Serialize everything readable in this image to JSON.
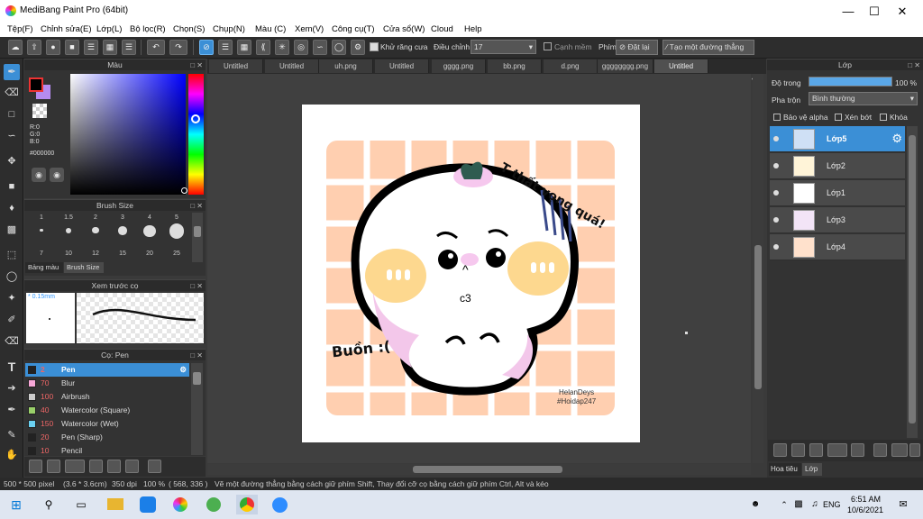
{
  "window": {
    "title": "MediBang Paint Pro (64bit)"
  },
  "menu": [
    "Tệp(F)",
    "Chỉnh sửa(E)",
    "Lớp(L)",
    "Bộ lọc(R)",
    "Chọn(S)",
    "Chụp(N)",
    "Màu (C)",
    "Xem(V)",
    "Công cụ(T)",
    "Cửa sổ(W)",
    "Cloud",
    "Help"
  ],
  "toolbar": {
    "antialias": "Khử răng cưa",
    "adjust_label": "Điều chỉnh",
    "adjust_value": "17",
    "edge": "Cạnh mềm",
    "pen_label": "Phím",
    "reset": "Đặt lại",
    "straight": "Tạo một đường thẳng"
  },
  "color_panel": {
    "title": "Màu",
    "r": "R:0",
    "g": "G:0",
    "b": "B:0",
    "hex": "#000000"
  },
  "brush_size": {
    "title": "Brush Size",
    "sizes_top": [
      "1",
      "1.5",
      "2",
      "3",
      "4",
      "5"
    ],
    "sizes_bottom": [
      "7",
      "10",
      "12",
      "15",
      "20",
      "25"
    ],
    "tab1": "Bảng màu",
    "tab2": "Brush Size"
  },
  "preview": {
    "title": "Xem trước cọ",
    "size": "0.15mm"
  },
  "brush_list": {
    "title": "Cọ: Pen",
    "items": [
      {
        "size": "2",
        "name": "Pen",
        "color": "#222222"
      },
      {
        "size": "70",
        "name": "Blur",
        "color": "#f7a8d8"
      },
      {
        "size": "100",
        "name": "Airbrush",
        "color": "#cccccc"
      },
      {
        "size": "40",
        "name": "Watercolor (Square)",
        "color": "#9ad06a"
      },
      {
        "size": "150",
        "name": "Watercolor (Wet)",
        "color": "#6ad0f0"
      },
      {
        "size": "20",
        "name": "Pen (Sharp)",
        "color": "#222222"
      },
      {
        "size": "10",
        "name": "Pencil",
        "color": "#222222"
      }
    ]
  },
  "tabs": [
    "Untitled",
    "Untitled",
    "uh.png",
    "Untitled",
    "gggg.png",
    "bb.png",
    "d.png",
    "gggggggg.png",
    "Untitled"
  ],
  "canvas": {
    "text_sad": "T thất vọng quá!",
    "text_buon": "Buồn :(",
    "sig1": "HelanDeys",
    "sig2": "#Hoidap247",
    "mouth": "^",
    "cheek": "c3"
  },
  "layers": {
    "title": "Lớp",
    "opacity_label": "Độ trong",
    "opacity_value": "100 %",
    "blend_label": "Pha trộn",
    "blend_value": "Bình thường",
    "protect_alpha": "Bảo vệ alpha",
    "clip": "Xén bớt",
    "lock": "Khóa",
    "items": [
      "Lớp5",
      "Lớp2",
      "Lớp1",
      "Lớp3",
      "Lớp4"
    ],
    "tab1": "Hoa tiêu",
    "tab2": "Lớp"
  },
  "status": {
    "size": "500 * 500 pixel",
    "cm": "(3.6 * 3.6cm)",
    "dpi": "350 dpi",
    "zoom": "100 %",
    "coord": "( 568, 336 )",
    "hint": "Vẽ một đường thẳng bằng cách giữ phím Shift, Thay đổi cỡ cọ bằng cách giữ phím Ctrl, Alt và kéo"
  },
  "taskbar": {
    "lang": "ENG",
    "time": "6:51 AM",
    "date": "10/6/2021"
  }
}
